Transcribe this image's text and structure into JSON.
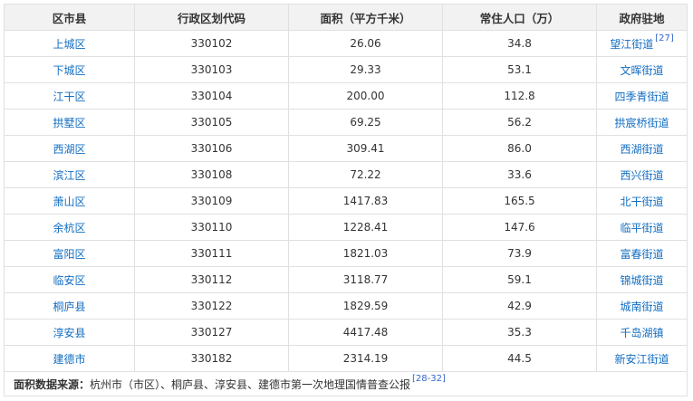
{
  "headers": [
    "区市县",
    "行政区划代码",
    "面积（平方千米）",
    "常住人口（万）",
    "政府驻地"
  ],
  "rows": [
    {
      "name": "上城区",
      "code": "330102",
      "area": "26.06",
      "pop": "34.8",
      "seat": "望江街道",
      "ref": "[27]"
    },
    {
      "name": "下城区",
      "code": "330103",
      "area": "29.33",
      "pop": "53.1",
      "seat": "文晖街道",
      "ref": ""
    },
    {
      "name": "江干区",
      "code": "330104",
      "area": "200.00",
      "pop": "112.8",
      "seat": "四季青街道",
      "ref": ""
    },
    {
      "name": "拱墅区",
      "code": "330105",
      "area": "69.25",
      "pop": "56.2",
      "seat": "拱宸桥街道",
      "ref": ""
    },
    {
      "name": "西湖区",
      "code": "330106",
      "area": "309.41",
      "pop": "86.0",
      "seat": "西湖街道",
      "ref": ""
    },
    {
      "name": "滨江区",
      "code": "330108",
      "area": "72.22",
      "pop": "33.6",
      "seat": "西兴街道",
      "ref": ""
    },
    {
      "name": "萧山区",
      "code": "330109",
      "area": "1417.83",
      "pop": "165.5",
      "seat": "北干街道",
      "ref": ""
    },
    {
      "name": "余杭区",
      "code": "330110",
      "area": "1228.41",
      "pop": "147.6",
      "seat": "临平街道",
      "ref": ""
    },
    {
      "name": "富阳区",
      "code": "330111",
      "area": "1821.03",
      "pop": "73.9",
      "seat": "富春街道",
      "ref": ""
    },
    {
      "name": "临安区",
      "code": "330112",
      "area": "3118.77",
      "pop": "59.1",
      "seat": "锦城街道",
      "ref": ""
    },
    {
      "name": "桐庐县",
      "code": "330122",
      "area": "1829.59",
      "pop": "42.9",
      "seat": "城南街道",
      "ref": ""
    },
    {
      "name": "淳安县",
      "code": "330127",
      "area": "4417.48",
      "pop": "35.3",
      "seat": "千岛湖镇",
      "ref": ""
    },
    {
      "name": "建德市",
      "code": "330182",
      "area": "2314.19",
      "pop": "44.5",
      "seat": "新安江街道",
      "ref": ""
    }
  ],
  "footer": {
    "label": "面积数据来源：",
    "text": "杭州市（市区）、桐庐县、淳安县、建德市第一次地理国情普查公报",
    "ref": "[28-32]"
  }
}
